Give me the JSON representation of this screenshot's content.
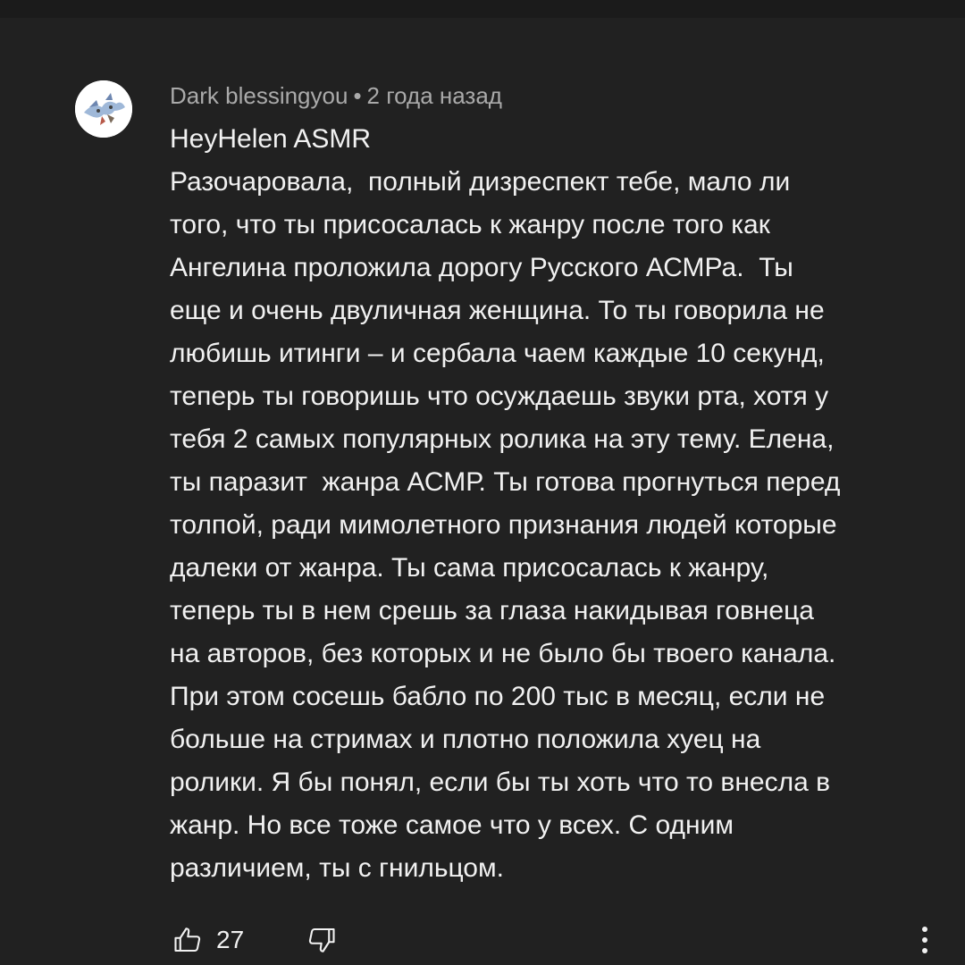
{
  "comment": {
    "author": "Dark blessingyou",
    "separator": "•",
    "timestamp": "2 года назад",
    "mention": "HeyHelen ASMR",
    "lines": [
      "Разочаровала,  полный дизреспект тебе, мало ли",
      "того, что ты присосалась к жанру после того как",
      "Ангелина проложила дорогу Русского АСМРа.  Ты",
      "еще и очень двуличная женщина. То ты говорила не",
      "любишь итинги – и сербала чаем каждые 10 секунд,",
      "теперь ты говоришь что осуждаешь звуки рта, хотя у",
      "тебя 2 самых популярных ролика на эту тему. Елена,",
      "ты паразит  жанра АСМР. Ты готова прогнуться перед",
      "толпой, ради мимолетного признания людей которые",
      "далеки от жанра. Ты сама присосалась к жанру,",
      "теперь ты в нем срешь за глаза накидывая говнеца",
      "на авторов, без которых и не было бы твоего канала.",
      "При этом сосешь бабло по 200 тыс в месяц, если не",
      "больше на стримах и плотно положила хуец на",
      "ролики. Я бы понял, если бы ты хоть что то внесла в",
      "жанр. Но все тоже самое что у всех. С одним",
      "различием, ты с гнильцом."
    ],
    "like_count": "27",
    "icons": {
      "like": "thumbs-up-icon",
      "dislike": "thumbs-down-icon",
      "more": "more-vert-icon"
    }
  },
  "colors": {
    "background": "#212121",
    "topbar": "#1b1b1b",
    "text_primary": "#f1f1f1",
    "text_secondary": "#aaaaaa"
  }
}
